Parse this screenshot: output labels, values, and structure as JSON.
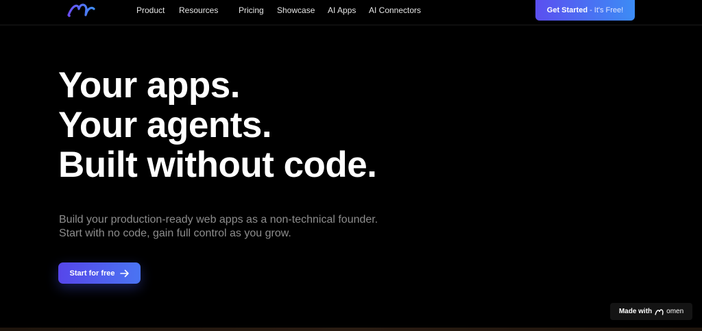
{
  "header": {
    "logo_icon": "stylized-m-logo-icon",
    "nav": [
      {
        "label": "Product"
      },
      {
        "label": "Resources"
      },
      {
        "label": "Pricing"
      },
      {
        "label": "Showcase"
      },
      {
        "label": "AI Apps"
      },
      {
        "label": "AI Connectors"
      }
    ],
    "cta": {
      "strong": "Get Started",
      "light": "- It's Free!"
    }
  },
  "hero": {
    "title_lines": [
      "Your apps.",
      "Your agents.",
      "Built without code."
    ],
    "subtitle_lines": [
      "Build your production-ready web apps as a non-technical founder.",
      "Start with no code, gain full control as you grow."
    ],
    "button": {
      "label": "Start for free",
      "icon": "arrow-right-icon"
    }
  },
  "badge": {
    "prefix": "Made with",
    "brand": "omen"
  },
  "colors": {
    "background": "#000000",
    "accent_start": "#5646ea",
    "accent_end": "#3c8cf5",
    "subtitle_text": "#8d8d8d"
  }
}
